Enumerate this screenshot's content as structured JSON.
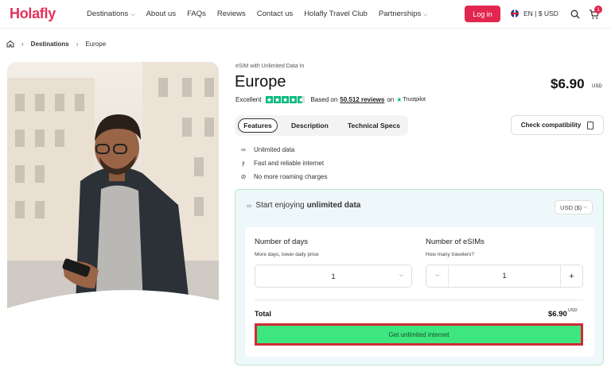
{
  "header": {
    "logo": "Holafly",
    "nav": [
      {
        "label": "Destinations",
        "dropdown": true
      },
      {
        "label": "About us",
        "dropdown": false
      },
      {
        "label": "FAQs",
        "dropdown": false
      },
      {
        "label": "Reviews",
        "dropdown": false
      },
      {
        "label": "Contact us",
        "dropdown": false
      },
      {
        "label": "Holafly Travel Club",
        "dropdown": false
      },
      {
        "label": "Partnerships",
        "dropdown": true
      }
    ],
    "login_label": "Log in",
    "language_label": "EN | $ USD",
    "cart_count": "1",
    "icons": {
      "search": "search-icon",
      "cart": "cart-icon",
      "flag": "uk-flag-icon"
    }
  },
  "breadcrumb": {
    "items": [
      "Destinations",
      "Europe"
    ]
  },
  "product": {
    "subtitle": "eSIM with Unlimited Data In",
    "title": "Europe",
    "price": "$6.90",
    "price_currency": "USD",
    "rating_label": "Excellent",
    "rating_stars": 4.5,
    "reviews_prefix": "Based on",
    "reviews_count": "50.512 reviews",
    "reviews_on": "on",
    "trustpilot_label": "Trustpilot"
  },
  "tabs": [
    {
      "label": "Features",
      "active": true
    },
    {
      "label": "Description",
      "active": false
    },
    {
      "label": "Technical Specs",
      "active": false
    }
  ],
  "check_compatibility_label": "Check compatibility",
  "features": [
    {
      "icon": "infinity-icon",
      "label": "Unlimited data"
    },
    {
      "icon": "lightning-icon",
      "label": "Fast and reliable internet"
    },
    {
      "icon": "no-roaming-icon",
      "label": "No more roaming charges"
    }
  ],
  "panel": {
    "heading_prefix": "Start enjoying",
    "heading_bold": "unlimited data",
    "currency_select": "USD ($)",
    "days_title": "Number of days",
    "days_sub": "More days, lower daily price",
    "days_value": "1",
    "esims_title": "Number of eSIMs",
    "esims_sub": "How many travelers?",
    "esims_value": "1",
    "minus": "−",
    "plus": "+",
    "total_label": "Total",
    "total_value": "$6.90",
    "total_currency": "USD",
    "cta_label": "Get unlimited internet"
  },
  "colors": {
    "brand": "#e2264f",
    "cta": "#3ee67f",
    "trustpilot": "#00b67a"
  }
}
